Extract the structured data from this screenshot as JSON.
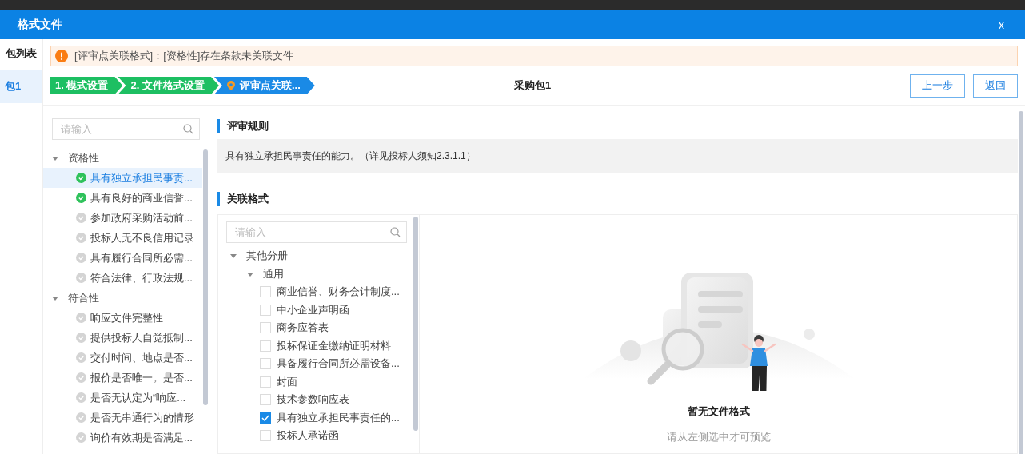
{
  "window": {
    "title": "格式文件",
    "close": "x"
  },
  "sidebar": {
    "header": "包列表",
    "items": [
      {
        "label": "包1",
        "selected": true
      }
    ]
  },
  "alert": {
    "text": "[评审点关联格式]：[资格性]存在条款未关联文件"
  },
  "steps": [
    {
      "label": "1. 模式设置",
      "completed": true,
      "selected": false
    },
    {
      "label": "2. 文件格式设置",
      "completed": true,
      "selected": false
    },
    {
      "label": "评审点关联...",
      "completed": false,
      "selected": true
    }
  ],
  "package_title": "采购包1",
  "buttons": [
    "上一步",
    "返回"
  ],
  "criteria": {
    "search": {
      "placeholder": "请输入"
    },
    "groups": [
      {
        "label": "资格性",
        "expanded": true,
        "children": [
          {
            "label": "具有独立承担民事责...",
            "linked": true,
            "selected": true
          },
          {
            "label": "具有良好的商业信誉...",
            "linked": true,
            "selected": false
          },
          {
            "label": "参加政府采购活动前...",
            "linked": false,
            "selected": false
          },
          {
            "label": "投标人无不良信用记录",
            "linked": false,
            "selected": false
          },
          {
            "label": "具有履行合同所必需...",
            "linked": false,
            "selected": false
          },
          {
            "label": "符合法律、行政法规...",
            "linked": false,
            "selected": false
          }
        ]
      },
      {
        "label": "符合性",
        "expanded": true,
        "children": [
          {
            "label": "响应文件完整性",
            "linked": false,
            "selected": false
          },
          {
            "label": "提供投标人自觉抵制...",
            "linked": false,
            "selected": false
          },
          {
            "label": "交付时间、地点是否...",
            "linked": false,
            "selected": false
          },
          {
            "label": "报价是否唯一。是否...",
            "linked": false,
            "selected": false
          },
          {
            "label": "是否无认定为“响应...",
            "linked": false,
            "selected": false
          },
          {
            "label": "是否无串通行为的情形",
            "linked": false,
            "selected": false
          },
          {
            "label": "询价有效期是否满足...",
            "linked": false,
            "selected": false
          }
        ]
      }
    ]
  },
  "rule": {
    "heading": "评审规则",
    "text": "具有独立承担民事责任的能力。（详见投标人须知2.3.1.1）"
  },
  "format": {
    "heading": "关联格式",
    "search": {
      "placeholder": "请输入"
    },
    "tree": [
      {
        "label": "其他分册",
        "expanded": true,
        "children": [
          {
            "label": "通用",
            "expanded": true,
            "children": [
              {
                "label": "商业信誉、财务会计制度...",
                "checked": false
              },
              {
                "label": "中小企业声明函",
                "checked": false
              },
              {
                "label": "商务应答表",
                "checked": false
              },
              {
                "label": "投标保证金缴纳证明材料",
                "checked": false
              },
              {
                "label": "具备履行合同所必需设备...",
                "checked": false
              },
              {
                "label": "封面",
                "checked": false
              },
              {
                "label": "技术参数响应表",
                "checked": false
              },
              {
                "label": "具有独立承担民事责任的...",
                "checked": true
              },
              {
                "label": "投标人承诺函",
                "checked": false
              }
            ]
          }
        ]
      }
    ],
    "empty": {
      "title": "暂无文件格式",
      "hint": "请从左侧选中才可预览"
    }
  }
}
